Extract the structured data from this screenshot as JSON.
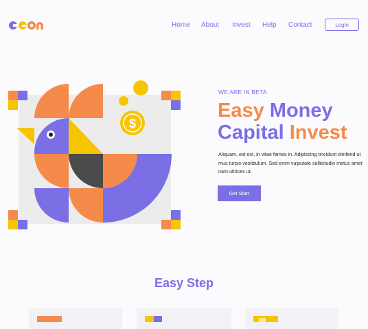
{
  "brand": {
    "logo_text": "Geon"
  },
  "nav": {
    "items": [
      "Home",
      "About",
      "Invest",
      "Help",
      "Contact"
    ],
    "login_label": "Login"
  },
  "hero": {
    "eyebrow": "WE ARE IN BETA",
    "headline_line1_a": "Easy",
    "headline_line1_b": "Money",
    "headline_line2_a": "Capital",
    "headline_line2_b": "Invest",
    "description": "Aliquam, est est, in vitae fames in. Adipiscing tincidunt eleifend ut mus turpis vestibulum. Sed enim vulputate sollicitudin metus amet nam ultrices ut.",
    "cta_label": "Get Start",
    "coin_symbol": "$"
  },
  "steps": {
    "title": "Easy Step"
  },
  "colors": {
    "purple": "#7b6fe6",
    "orange": "#f58a4b",
    "yellow": "#f7c500",
    "dark": "#4a4a4a",
    "gray": "#ececec"
  }
}
